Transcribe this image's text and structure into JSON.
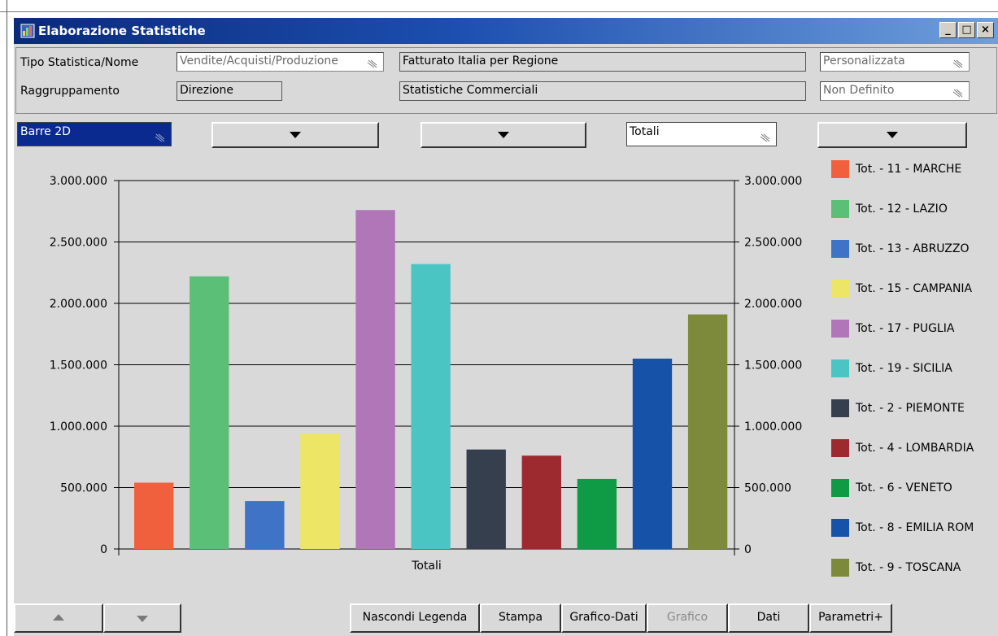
{
  "window": {
    "title": "Elaborazione Statistiche",
    "controls": [
      "_",
      "□",
      "×"
    ]
  },
  "header": {
    "tipo_label": "Tipo Statistica/Nome",
    "tipo_value": "Vendite/Acquisti/Produzione",
    "nome_value": "Fatturato Italia per Regione",
    "personal_value": "Personalizzata",
    "raggruppamento_label": "Raggruppamento",
    "raggruppamento_value": "Direzione",
    "categoria_value": "Statistiche Commerciali",
    "definizione_value": "Non Definito"
  },
  "toolbar": {
    "chart_type": "Barre 2D",
    "series_mode": "Totali"
  },
  "chart_data": {
    "type": "bar",
    "categories": [
      "Totali"
    ],
    "xlabel": "Totali",
    "ylim": [
      0,
      3000000
    ],
    "yticks": [
      "0",
      "500.000",
      "1.000.000",
      "1.500.000",
      "2.000.000",
      "2.500.000",
      "3.000.000"
    ],
    "ytick_values": [
      0,
      500000,
      1000000,
      1500000,
      2000000,
      2500000,
      3000000
    ],
    "grid": true,
    "legend_position": "right",
    "series": [
      {
        "name": "Tot. - 11  - MARCHE",
        "values": [
          540000
        ],
        "color": "#f0603c"
      },
      {
        "name": "Tot. - 12  - LAZIO",
        "values": [
          2220000
        ],
        "color": "#5cbf78"
      },
      {
        "name": "Tot. - 13  - ABRUZZO",
        "values": [
          390000
        ],
        "color": "#3e73c6"
      },
      {
        "name": "Tot. - 15  - CAMPANIA",
        "values": [
          940000
        ],
        "color": "#ece566"
      },
      {
        "name": "Tot. - 17  - PUGLIA",
        "values": [
          2760000
        ],
        "color": "#b076b8"
      },
      {
        "name": "Tot. - 19  - SICILIA",
        "values": [
          2320000
        ],
        "color": "#4bc4c4"
      },
      {
        "name": "Tot. - 2    - PIEMONTE",
        "values": [
          810000
        ],
        "color": "#353f4d"
      },
      {
        "name": "Tot. - 4    - LOMBARDIA",
        "values": [
          760000
        ],
        "color": "#9c2a2e"
      },
      {
        "name": "Tot. - 6    - VENETO",
        "values": [
          570000
        ],
        "color": "#0f9a45"
      },
      {
        "name": "Tot. - 8    - EMILIA ROM",
        "values": [
          1550000
        ],
        "color": "#1652a8"
      },
      {
        "name": "Tot. - 9    - TOSCANA",
        "values": [
          1910000
        ],
        "color": "#7e8a3b"
      }
    ]
  },
  "buttons": {
    "nascondi_legenda": "Nascondi Legenda",
    "stampa": "Stampa",
    "grafico_dati": "Grafico-Dati",
    "grafico": "Grafico",
    "dati": "Dati",
    "parametri": "Parametri+"
  }
}
